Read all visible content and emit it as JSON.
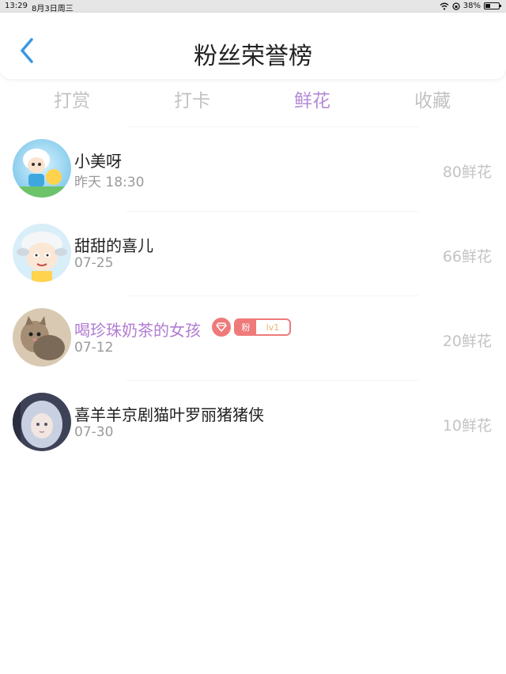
{
  "status_bar": {
    "time": "13:29",
    "date": "8月3日周三",
    "battery": "38%"
  },
  "header": {
    "title": "粉丝荣誉榜"
  },
  "tabs": [
    {
      "label": "打赏",
      "active": false
    },
    {
      "label": "打卡",
      "active": false
    },
    {
      "label": "鲜花",
      "active": true
    },
    {
      "label": "收藏",
      "active": false
    }
  ],
  "colors": {
    "accent": "#b48ad6",
    "back_arrow": "#3a98e6",
    "badge": "#ee7a7a"
  },
  "fans": [
    {
      "name": "小美呀",
      "time": "昨天 18:30",
      "flowers": "80鲜花",
      "avatar": "cartoon-goat-avatar"
    },
    {
      "name": "甜甜的喜儿",
      "time": "07-25",
      "flowers": "66鲜花",
      "avatar": "cartoon-sheep-avatar"
    },
    {
      "name": "喝珍珠奶茶的女孩",
      "time": "07-12",
      "flowers": "20鲜花",
      "avatar": "kitten-photo-avatar",
      "badge": {
        "label": "粉",
        "level": "lv1",
        "icon": "diamond-icon"
      }
    },
    {
      "name": "喜羊羊京剧猫叶罗丽猪猪侠",
      "time": "07-30",
      "flowers": "10鲜花",
      "avatar": "anime-girl-avatar"
    }
  ]
}
